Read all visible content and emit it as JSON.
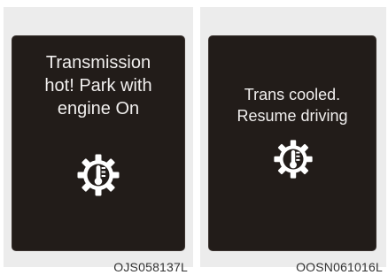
{
  "left_display": {
    "message": "Transmission\nhot! Park with\nengine On",
    "icon": "transmission-temperature-icon",
    "code": "OJS058137L"
  },
  "right_display": {
    "message": "Trans cooled.\nResume driving",
    "icon": "transmission-temperature-icon",
    "code": "OOSN061016L"
  },
  "colors": {
    "screen_background": "#221c19",
    "text": "#f1efee",
    "icon": "#ffffff",
    "frame": "#ececec"
  }
}
